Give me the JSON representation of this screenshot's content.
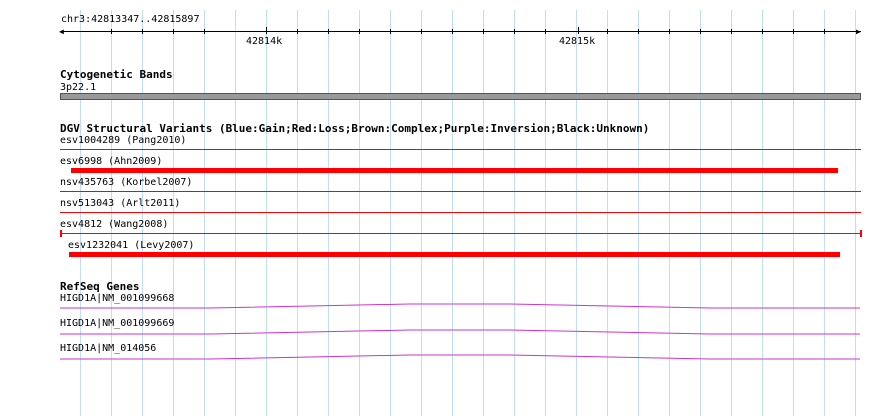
{
  "ruler": {
    "region": "chr3:42813347..42815897",
    "labels": [
      {
        "text": "42814k"
      },
      {
        "text": "42815k"
      }
    ]
  },
  "tracks": {
    "cytoband": {
      "title": "Cytogenetic Bands",
      "band": "3p22.1"
    },
    "dgv": {
      "title": "DGV Structural Variants (Blue:Gain;Red:Loss;Brown:Complex;Purple:Inversion;Black:Unknown)",
      "variants": [
        {
          "label": "esv1004289 (Pang2010)",
          "color": "#ff0000"
        },
        {
          "label": "esv6998 (Ahn2009)",
          "color": "#ff0000"
        },
        {
          "label": "nsv435763 (Korbel2007)",
          "color": "#ff0000"
        },
        {
          "label": "nsv513043 (Arlt2011)",
          "color": "#ff0000"
        },
        {
          "label": "esv4812 (Wang2008)",
          "color": "#ff0000"
        },
        {
          "label": "esv1232041 (Levy2007)",
          "color": "#ff0000"
        }
      ]
    },
    "refseq": {
      "title": "RefSeq Genes",
      "genes": [
        {
          "label": "HIGD1A|NM_001099668",
          "color": "#cc33cc"
        },
        {
          "label": "HIGD1A|NM_001099669",
          "color": "#cc33cc"
        },
        {
          "label": "HIGD1A|NM_014056",
          "color": "#cc33cc"
        }
      ]
    }
  },
  "colors": {
    "grid": "#bfe0f0",
    "loss": "#ff0000",
    "gene": "#cc33cc",
    "band": "#999999"
  }
}
